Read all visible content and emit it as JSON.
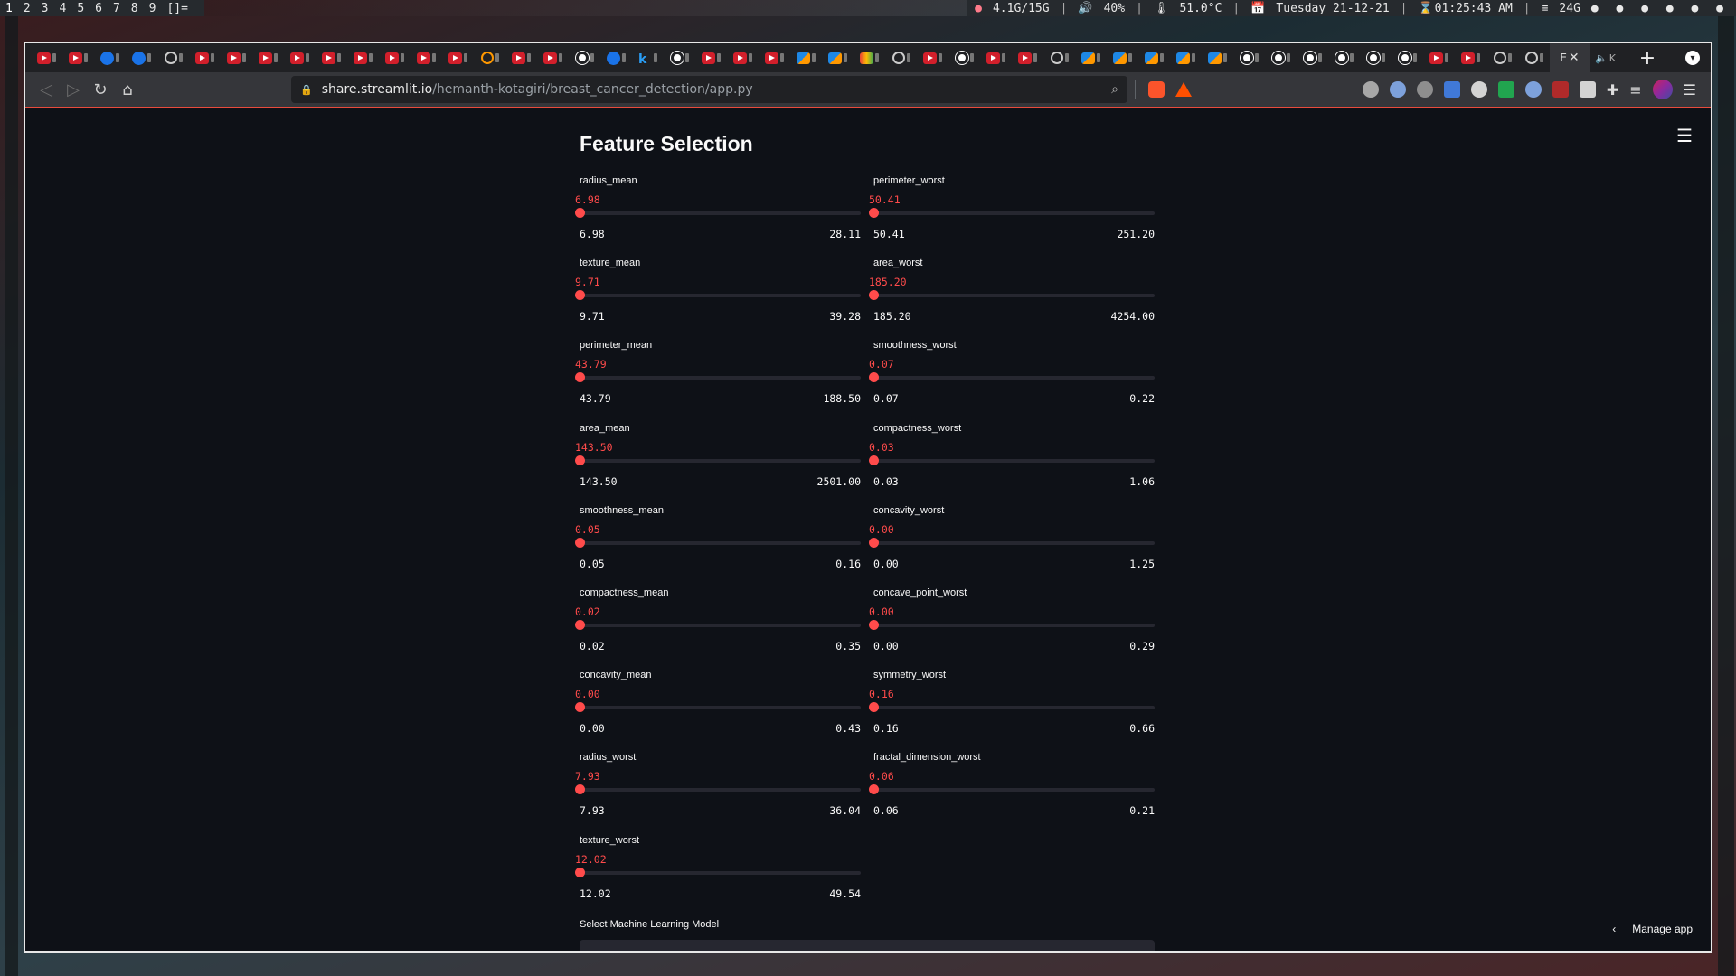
{
  "topbar": {
    "workspaces": [
      "1",
      "2",
      "3",
      "4",
      "5",
      "6",
      "7",
      "8",
      "9"
    ],
    "layout": "[]=",
    "memory": "4.1G/15G",
    "volume": "40%",
    "temperature": "51.0°C",
    "date": "Tuesday 21-12-21",
    "time": "01:25:43 AM",
    "disk": "24G"
  },
  "browser": {
    "url_host": "share.streamlit.io",
    "url_path": "/hemanth-kotagiri/breast_cancer_detection/app.py",
    "tab_icons": [
      "youtube",
      "youtube",
      "c-icon",
      "c-icon",
      "globe",
      "youtube",
      "youtube",
      "youtube",
      "youtube",
      "youtube",
      "youtube",
      "youtube",
      "youtube",
      "youtube",
      "globe-orange",
      "youtube",
      "youtube",
      "github",
      "p-icon",
      "k-icon",
      "github",
      "youtube",
      "youtube",
      "youtube",
      "ms-icon",
      "ms-icon",
      "gmail",
      "a-icon",
      "youtube",
      "github",
      "youtube",
      "youtube",
      "globe",
      "ms-icon",
      "ms-icon",
      "ms-icon",
      "ms-icon",
      "ms-icon",
      "github",
      "github",
      "github",
      "github",
      "github",
      "github",
      "youtube",
      "youtube",
      "a-icon",
      "globe"
    ],
    "active_tab_letter": "E",
    "new_tab_label": "+"
  },
  "app": {
    "title": "Feature Selection",
    "menu_icon": "☰",
    "model_label": "Select Machine Learning Model",
    "manage_label": "Manage app"
  },
  "sliders": [
    {
      "label": "radius_mean",
      "value": "6.98",
      "min": "6.98",
      "max": "28.11",
      "fraction": 0
    },
    {
      "label": "texture_mean",
      "value": "9.71",
      "min": "9.71",
      "max": "39.28",
      "fraction": 0
    },
    {
      "label": "perimeter_mean",
      "value": "43.79",
      "min": "43.79",
      "max": "188.50",
      "fraction": 0
    },
    {
      "label": "area_mean",
      "value": "143.50",
      "min": "143.50",
      "max": "2501.00",
      "fraction": 0
    },
    {
      "label": "smoothness_mean",
      "value": "0.05",
      "min": "0.05",
      "max": "0.16",
      "fraction": 0
    },
    {
      "label": "compactness_mean",
      "value": "0.02",
      "min": "0.02",
      "max": "0.35",
      "fraction": 0
    },
    {
      "label": "concavity_mean",
      "value": "0.00",
      "min": "0.00",
      "max": "0.43",
      "fraction": 0
    },
    {
      "label": "radius_worst",
      "value": "7.93",
      "min": "7.93",
      "max": "36.04",
      "fraction": 0
    },
    {
      "label": "texture_worst",
      "value": "12.02",
      "min": "12.02",
      "max": "49.54",
      "fraction": 0
    },
    {
      "label": "perimeter_worst",
      "value": "50.41",
      "min": "50.41",
      "max": "251.20",
      "fraction": 0
    },
    {
      "label": "area_worst",
      "value": "185.20",
      "min": "185.20",
      "max": "4254.00",
      "fraction": 0
    },
    {
      "label": "smoothness_worst",
      "value": "0.07",
      "min": "0.07",
      "max": "0.22",
      "fraction": 0
    },
    {
      "label": "compactness_worst",
      "value": "0.03",
      "min": "0.03",
      "max": "1.06",
      "fraction": 0
    },
    {
      "label": "concavity_worst",
      "value": "0.00",
      "min": "0.00",
      "max": "1.25",
      "fraction": 0
    },
    {
      "label": "concave_point_worst",
      "value": "0.00",
      "min": "0.00",
      "max": "0.29",
      "fraction": 0
    },
    {
      "label": "symmetry_worst",
      "value": "0.16",
      "min": "0.16",
      "max": "0.66",
      "fraction": 0
    },
    {
      "label": "fractal_dimension_worst",
      "value": "0.06",
      "min": "0.06",
      "max": "0.21",
      "fraction": 0
    }
  ],
  "colors": {
    "accent": "#ff4b4b",
    "background": "#0e1117",
    "track": "#262730",
    "text": "#fafafa"
  }
}
